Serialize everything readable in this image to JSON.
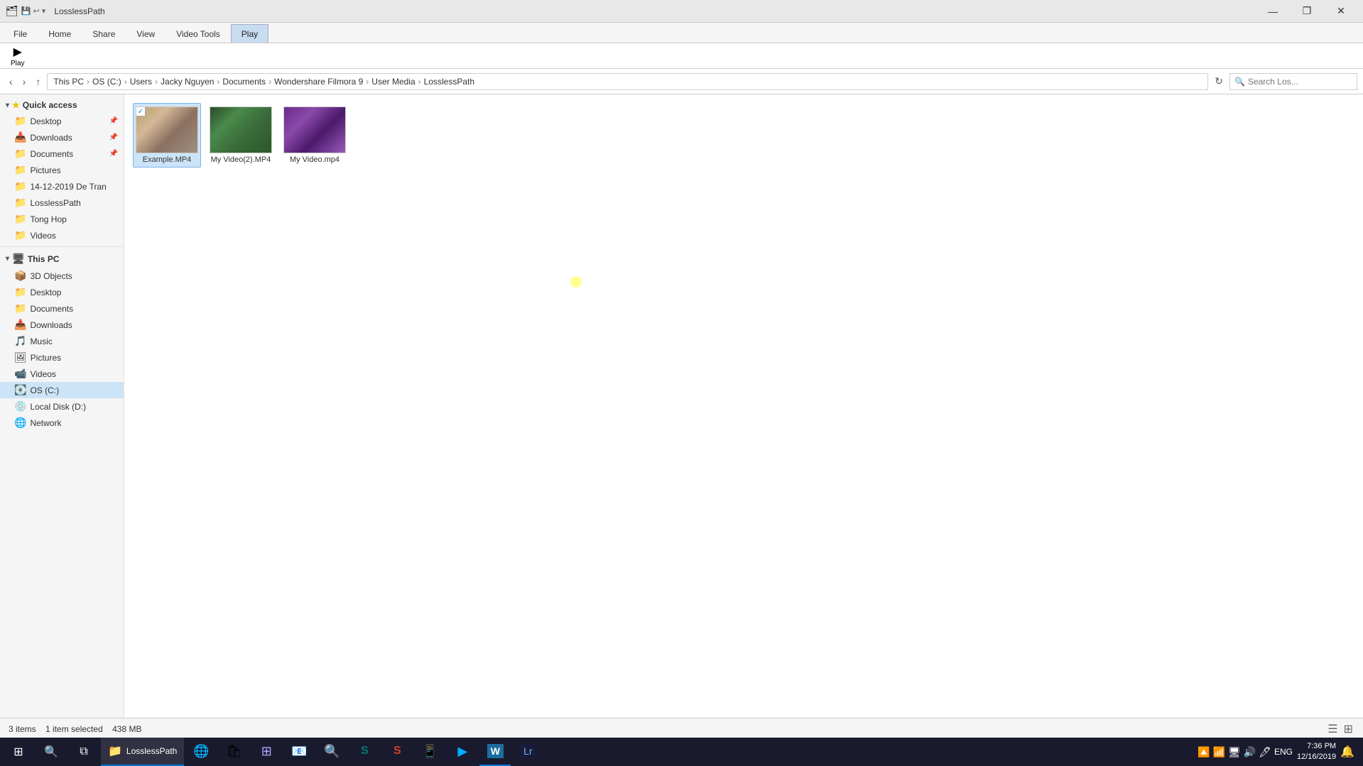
{
  "titleBar": {
    "title": "LosslessPath",
    "quickAccessToolbar": [
      "save-icon",
      "undo-icon"
    ],
    "controls": {
      "minimize": "—",
      "maximize": "❐",
      "close": "✕"
    }
  },
  "ribbon": {
    "tabs": [
      {
        "id": "file",
        "label": "File"
      },
      {
        "id": "home",
        "label": "Home"
      },
      {
        "id": "share",
        "label": "Share"
      },
      {
        "id": "view",
        "label": "View"
      },
      {
        "id": "videotools",
        "label": "Video Tools"
      },
      {
        "id": "play",
        "label": "Play",
        "active": true,
        "highlighted": true
      }
    ]
  },
  "addressBar": {
    "path": [
      "This PC",
      "OS (C:)",
      "Users",
      "Jacky Nguyen",
      "Documents",
      "Wondershare Filmora 9",
      "User Media",
      "LosslessPath"
    ],
    "searchPlaceholder": "Search Los..."
  },
  "sidebar": {
    "quickAccess": {
      "header": "Quick access",
      "items": [
        {
          "label": "Desktop",
          "icon": "folder",
          "pinned": true
        },
        {
          "label": "Downloads",
          "icon": "download-folder",
          "pinned": true
        },
        {
          "label": "Documents",
          "icon": "folder",
          "pinned": true
        },
        {
          "label": "Pictures",
          "icon": "folder"
        },
        {
          "label": "14-12-2019 De Tran",
          "icon": "folder"
        },
        {
          "label": "LosslessPath",
          "icon": "folder"
        },
        {
          "label": "Tong Hop",
          "icon": "folder"
        },
        {
          "label": "Videos",
          "icon": "folder"
        }
      ]
    },
    "thisPC": {
      "header": "This PC",
      "items": [
        {
          "label": "3D Objects",
          "icon": "3d-folder"
        },
        {
          "label": "Desktop",
          "icon": "folder"
        },
        {
          "label": "Documents",
          "icon": "folder"
        },
        {
          "label": "Downloads",
          "icon": "download-folder"
        },
        {
          "label": "Music",
          "icon": "music"
        },
        {
          "label": "Pictures",
          "icon": "pictures"
        },
        {
          "label": "Videos",
          "icon": "videos"
        },
        {
          "label": "OS (C:)",
          "icon": "drive",
          "selected": true
        },
        {
          "label": "Local Disk (D:)",
          "icon": "local-drive"
        },
        {
          "label": "Network",
          "icon": "network"
        }
      ]
    }
  },
  "files": [
    {
      "name": "Example.MP4",
      "thumb": "example",
      "selected": true
    },
    {
      "name": "My Video(2).MP4",
      "thumb": "video2",
      "selected": false
    },
    {
      "name": "My Video.mp4",
      "thumb": "myvideo",
      "selected": false
    }
  ],
  "statusBar": {
    "text": "3 items",
    "selected": "1 item selected",
    "size": "438 MB"
  },
  "taskbar": {
    "startLabel": "⊞",
    "searchLabel": "🔍",
    "taskviewLabel": "⧉",
    "items": [
      {
        "label": "LosslessPath",
        "icon": "folder",
        "active": true
      }
    ],
    "apps": [
      {
        "name": "chrome",
        "icon": "🌐"
      },
      {
        "name": "store",
        "icon": "🛍"
      },
      {
        "name": "apps",
        "icon": "⊞"
      },
      {
        "name": "app1",
        "icon": "📧"
      },
      {
        "name": "search",
        "icon": "🔍"
      },
      {
        "name": "sway",
        "icon": "S"
      },
      {
        "name": "slide",
        "icon": "S"
      },
      {
        "name": "app2",
        "icon": "📱"
      },
      {
        "name": "filmora",
        "icon": "▶"
      },
      {
        "name": "lr",
        "icon": "Lr"
      }
    ],
    "time": "7:36 PM",
    "date": "12/16/2019",
    "tray": [
      "🔼",
      "📶",
      "🖥",
      "🔊",
      "🖊",
      "ENG"
    ]
  }
}
